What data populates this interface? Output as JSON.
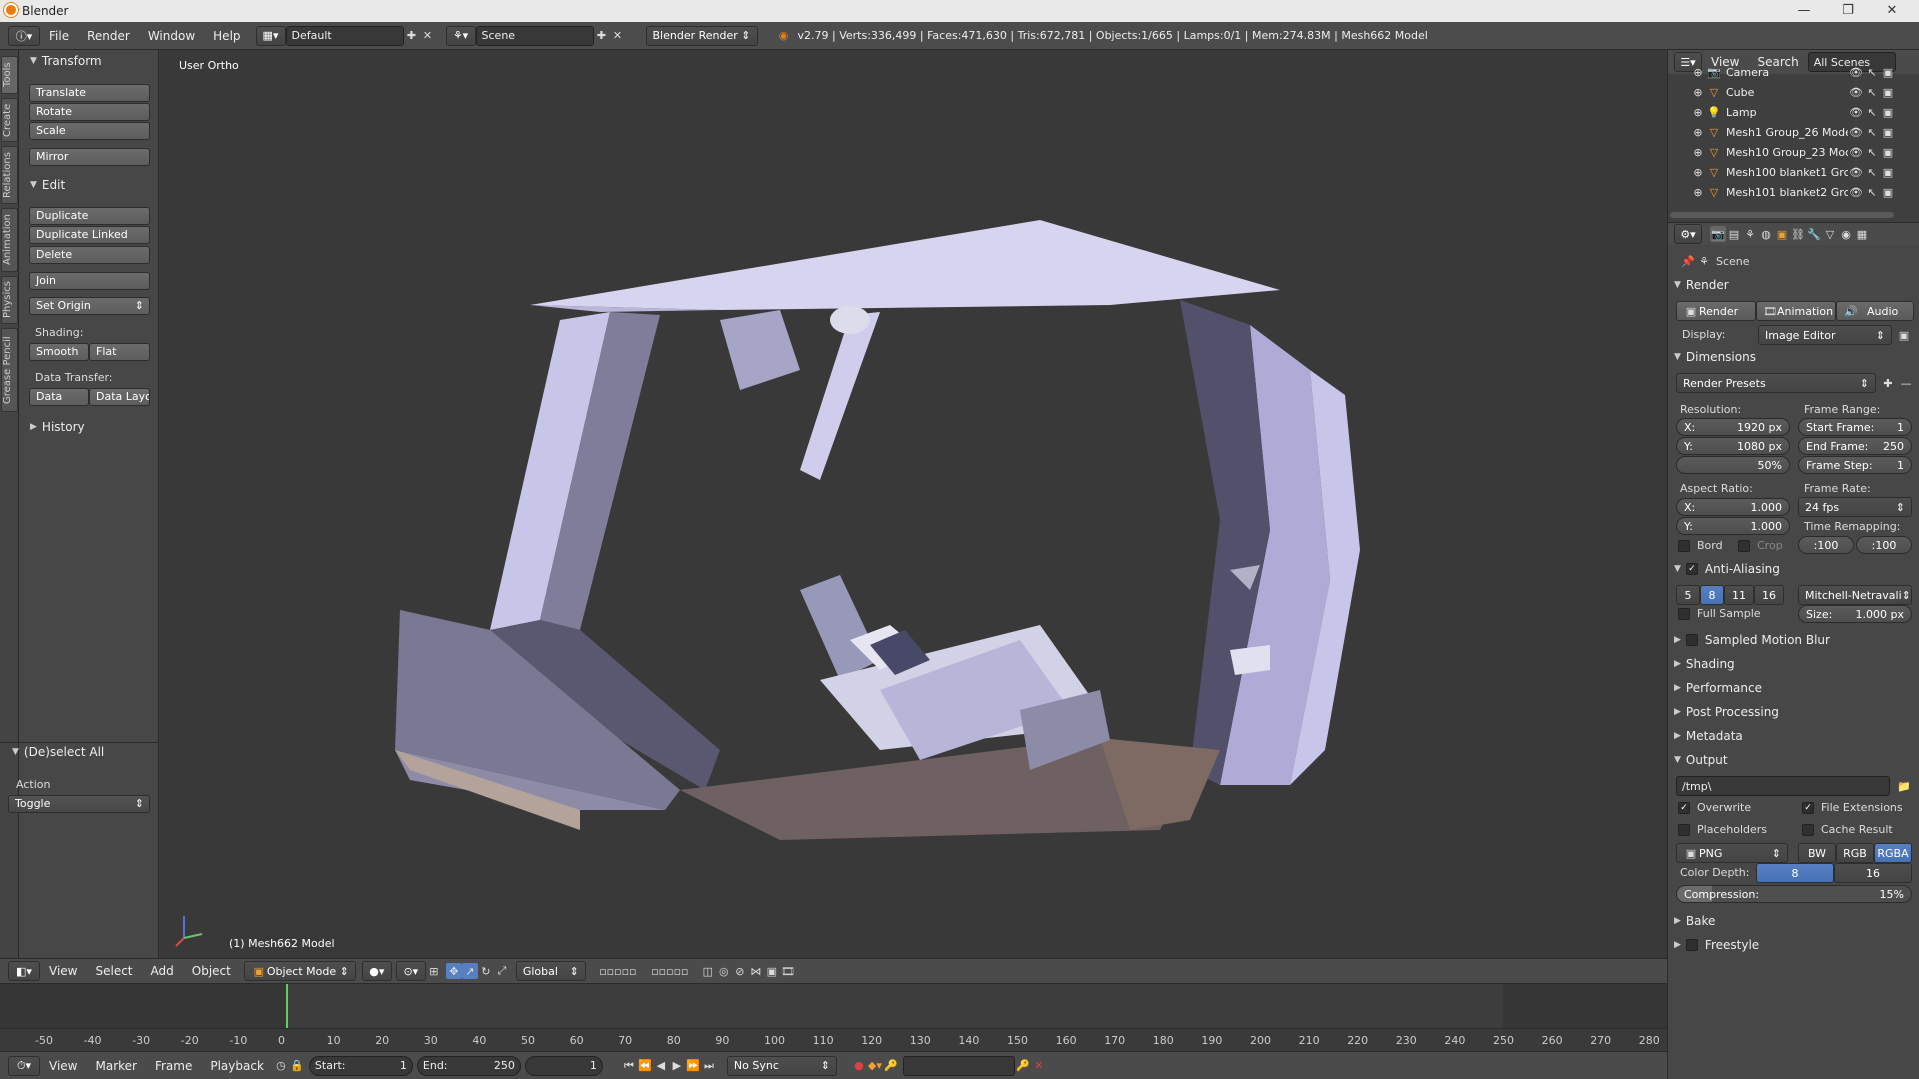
{
  "window": {
    "title": "Blender",
    "controls": [
      "—",
      "❐",
      "✕"
    ]
  },
  "topbar": {
    "menus": [
      "File",
      "Render",
      "Window",
      "Help"
    ],
    "layout": "Default",
    "scene": "Scene",
    "engine": "Blender Render",
    "stats": "v2.79 | Verts:336,499 | Faces:471,630 | Tris:672,781 | Objects:1/665 | Lamps:0/1 | Mem:274.83M | Mesh662 Model"
  },
  "toolstrip": {
    "tabs": [
      "Tools",
      "Create",
      "Relations",
      "Animation",
      "Physics",
      "Grease Pencil"
    ]
  },
  "toolshelf": {
    "transform": {
      "title": "Transform",
      "buttons": [
        "Translate",
        "Rotate",
        "Scale",
        "Mirror"
      ]
    },
    "edit": {
      "title": "Edit",
      "buttons": [
        "Duplicate",
        "Duplicate Linked",
        "Delete",
        "Join"
      ],
      "set_origin": "Set Origin"
    },
    "shading": {
      "label": "Shading:",
      "smooth": "Smooth",
      "flat": "Flat"
    },
    "data_transfer": {
      "label": "Data Transfer:",
      "data": "Data",
      "data_layout": "Data Layo"
    },
    "history": {
      "title": "History"
    },
    "operator": {
      "title": "(De)select All",
      "action_label": "Action",
      "action_value": "Toggle"
    }
  },
  "viewport": {
    "view_label": "User Ortho",
    "object_label": "(1) Mesh662 Model"
  },
  "viewport_header": {
    "menus": [
      "View",
      "Select",
      "Add",
      "Object"
    ],
    "mode": "Object Mode",
    "orientation": "Global"
  },
  "timeline": {
    "ticks": [
      "-50",
      "-40",
      "-30",
      "-20",
      "-10",
      "0",
      "10",
      "20",
      "30",
      "40",
      "50",
      "60",
      "70",
      "80",
      "90",
      "100",
      "110",
      "120",
      "130",
      "140",
      "150",
      "160",
      "170",
      "180",
      "190",
      "200",
      "210",
      "220",
      "230",
      "240",
      "250",
      "260",
      "270",
      "280"
    ],
    "current_frame_marker": 0
  },
  "timeline_header": {
    "menus": [
      "View",
      "Marker",
      "Frame",
      "Playback"
    ],
    "start": "Start:",
    "start_value": "1",
    "end": "End:",
    "end_value": "250",
    "current": "1",
    "sync": "No Sync"
  },
  "outliner": {
    "menus": [
      "View",
      "Search"
    ],
    "filter": "All Scenes",
    "rows": [
      "Camera",
      "Cube",
      "Lamp",
      "Mesh1 Group_26 Mode",
      "Mesh10 Group_23 Moc",
      "Mesh100 blanket1 Grc",
      "Mesh101 blanket2 Grc"
    ]
  },
  "properties": {
    "context": "Scene",
    "render_section": "Render",
    "render_buttons": [
      "Render",
      "Animation",
      "Audio"
    ],
    "display_label": "Display:",
    "display_value": "Image Editor",
    "dimensions": "Dimensions",
    "render_presets": "Render Presets",
    "resolution_label": "Resolution:",
    "res_x": "1920 px",
    "res_y": "1080 px",
    "res_pct": "50%",
    "frame_range_label": "Frame Range:",
    "start_frame": "Start Frame:",
    "start_frame_value": "1",
    "end_frame": "End Frame:",
    "end_frame_value": "250",
    "frame_step": "Frame Step:",
    "frame_step_value": "1",
    "aspect_label": "Aspect Ratio:",
    "aspect_x": "1.000",
    "aspect_y": "1.000",
    "frame_rate_label": "Frame Rate:",
    "frame_rate": "24 fps",
    "time_remap_label": "Time Remapping:",
    "remap_old": ":100",
    "remap_new": ":100",
    "bord": "Bord",
    "crop": "Crop",
    "anti_aliasing": "Anti-Aliasing",
    "aa_samples": [
      "5",
      "8",
      "11",
      "16"
    ],
    "aa_filter": "Mitchell-Netravali",
    "full_sample": "Full Sample",
    "size_label": "Size:",
    "size_value": "1.000 px",
    "collapsed_sections": [
      "Sampled Motion Blur",
      "Shading",
      "Performance",
      "Post Processing",
      "Metadata"
    ],
    "output": "Output",
    "output_path": "/tmp\\",
    "overwrite": "Overwrite",
    "file_extensions": "File Extensions",
    "placeholders": "Placeholders",
    "cache_result": "Cache Result",
    "format": "PNG",
    "color_modes": [
      "BW",
      "RGB",
      "RGBA"
    ],
    "color_depth_label": "Color Depth:",
    "color_depths": [
      "8",
      "16"
    ],
    "compression_label": "Compression:",
    "compression_value": "15%",
    "bake": "Bake",
    "freestyle": "Freestyle",
    "x_label": "X:",
    "y_label": "Y:"
  }
}
